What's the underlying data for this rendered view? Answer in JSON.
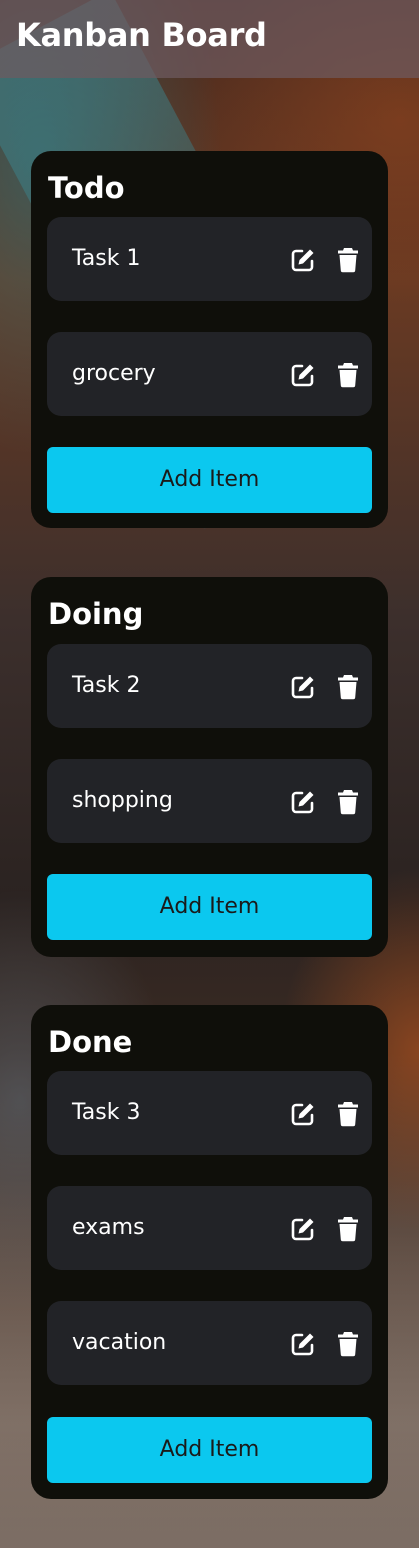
{
  "app": {
    "title": "Kanban Board"
  },
  "colors": {
    "column_bg": "#0f0f0a",
    "card_bg": "#222327",
    "accent": "#0bc8ef"
  },
  "columns": [
    {
      "title": "Todo",
      "items": [
        "Task 1",
        "grocery"
      ],
      "add_label": "Add Item"
    },
    {
      "title": "Doing",
      "items": [
        "Task 2",
        "shopping"
      ],
      "add_label": "Add Item"
    },
    {
      "title": "Done",
      "items": [
        "Task 3",
        "exams",
        "vacation"
      ],
      "add_label": "Add Item"
    }
  ],
  "icons": {
    "edit": "edit-icon",
    "delete": "trash-icon"
  }
}
